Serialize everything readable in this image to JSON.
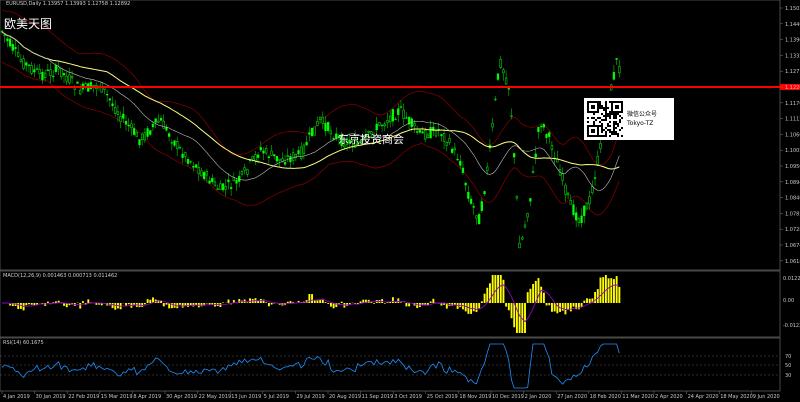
{
  "header": {
    "symbol_info": "EURUSD,Daily  1.13957 1.13993 1.12758 1.12892",
    "main_title": "欧美天图",
    "macd_label": "MACD(12,26,9) 0.001463 0.000713 0.011462",
    "rsi_label": "RSI(14) 60.1675"
  },
  "watermark": "东京投资商会",
  "qr": {
    "line1": "微信公众号",
    "line2": "Tokyo-TZ"
  },
  "price_axis": [
    "1.15020",
    "1.14460",
    "1.13905",
    "1.13350",
    "1.12775",
    "1.12260",
    "1.11705",
    "1.11150",
    "1.10600",
    "1.10050",
    "1.09500",
    "1.08945",
    "1.08400",
    "1.07850",
    "1.07285",
    "1.06740",
    "1.06185"
  ],
  "macd_axis": [
    "0.012203",
    "0.00",
    "-0.012203"
  ],
  "rsi_axis": [
    "70",
    "50",
    "30"
  ],
  "date_axis": [
    "4 Jan 2019",
    "30 Jan 2019",
    "22 Feb 2019",
    "15 Mar 2019",
    "8 Apr 2019",
    "30 Apr 2019",
    "22 May 2019",
    "13 Jun 2019",
    "5 Jul 2019",
    "29 Jul 2019",
    "20 Aug 2019",
    "11 Sep 2019",
    "3 Oct 2019",
    "25 Oct 2019",
    "18 Nov 2019",
    "10 Dec 2019",
    "2 Jan 2020",
    "27 Jan 2020",
    "18 Feb 2020",
    "11 Mar 2020",
    "2 Apr 2020",
    "24 Apr 2020",
    "18 May 2020",
    "9 Jun 2020"
  ],
  "colors": {
    "bull": "#00ff00",
    "bear": "#00c800",
    "ma_slow": "#ffff80",
    "ma_fast": "#c0c0c0",
    "bands": "#8b0000",
    "hline": "#ff0000",
    "macd_hist": "#ffff00",
    "macd_signal": "#9400d3",
    "macd_main": "#000000",
    "rsi_line": "#1e90ff",
    "grid": "#7a7a7a"
  }
}
